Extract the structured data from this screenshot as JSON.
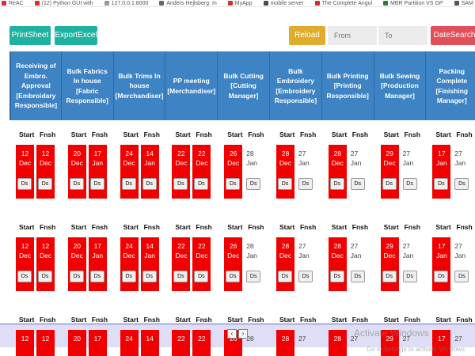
{
  "bookmarks": [
    {
      "label": "ReAC",
      "color": "#cc3333"
    },
    {
      "label": "(12) Python GUI with",
      "color": "#e52d27"
    },
    {
      "label": "127.0.0.1:8000",
      "color": "#999999"
    },
    {
      "label": "Anders Hejlsberg: In",
      "color": "#666666"
    },
    {
      "label": "MyApp",
      "color": "#d32f2f"
    },
    {
      "label": "mobile server",
      "color": "#4a4a4a"
    },
    {
      "label": "The Complete Angul",
      "color": "#d32f2f"
    },
    {
      "label": "MBR Partition VS GP",
      "color": "#2e7d32"
    },
    {
      "label": "SAM ONLINE",
      "color": "#555555"
    }
  ],
  "toolbar": {
    "print_label": "PrintSheet",
    "excel_label": "ExportExcel",
    "reload_label": "Reload",
    "from_placeholder": "From",
    "to_placeholder": "To",
    "datesearch_label": "DateSearch"
  },
  "colors": {
    "teal": "#20b2a0",
    "reload": "#e0ac2c",
    "datesearch": "#e14f58",
    "header": "#3e83c4",
    "overdue": "#f00000"
  },
  "columns": [
    [
      "Receiving of",
      "Embro.",
      "Approval",
      "[Embroidary",
      "Responsible]"
    ],
    [
      "Bulk Fabrics",
      "In house",
      "[Fabric",
      "Responsible]"
    ],
    [
      "Bulk Trims In",
      "house",
      "[Merchandiser]"
    ],
    [
      "PP meeting",
      "[Merchandiser]"
    ],
    [
      "Bulk Cutting",
      "[Cutting",
      "Manager]"
    ],
    [
      "Bulk",
      "Embroidery",
      "[Embroidery",
      "Responsible]"
    ],
    [
      "Bulk Printing",
      "[Printing",
      "Responsible]"
    ],
    [
      "Bulk Sewing",
      "[Production",
      "Manager]"
    ],
    [
      "Packing",
      "Complete",
      "[Finishing",
      "Manager]"
    ]
  ],
  "cell_labels": {
    "start": "Start",
    "finish": "Fnsh",
    "ds": "Ds"
  },
  "rows": [
    [
      {
        "s": [
          "12",
          "Dec"
        ],
        "f": [
          "12",
          "Dec"
        ],
        "s_red": true,
        "f_red": true
      },
      {
        "s": [
          "20",
          "Dec"
        ],
        "f": [
          "17",
          "Jan"
        ],
        "s_red": true,
        "f_red": true
      },
      {
        "s": [
          "24",
          "Dec"
        ],
        "f": [
          "14",
          "Jan"
        ],
        "s_red": true,
        "f_red": true
      },
      {
        "s": [
          "22",
          "Dec"
        ],
        "f": [
          "22",
          "Dec"
        ],
        "s_red": true,
        "f_red": true
      },
      {
        "s": [
          "26",
          "Dec"
        ],
        "f": [
          "28",
          "Jan"
        ],
        "s_red": true,
        "f_red": false
      },
      {
        "s": [
          "28",
          "Dec"
        ],
        "f": [
          "27",
          "Jan"
        ],
        "s_red": true,
        "f_red": false
      },
      {
        "s": [
          "28",
          "Dec"
        ],
        "f": [
          "27",
          "Jan"
        ],
        "s_red": true,
        "f_red": false
      },
      {
        "s": [
          "29",
          "Dec"
        ],
        "f": [
          "27",
          "Jan"
        ],
        "s_red": true,
        "f_red": false
      },
      {
        "s": [
          "17",
          "Jan"
        ],
        "f": [
          "27",
          "Jan"
        ],
        "s_red": true,
        "f_red": false
      }
    ],
    [
      {
        "s": [
          "12",
          "Dec"
        ],
        "f": [
          "12",
          "Dec"
        ],
        "s_red": true,
        "f_red": true
      },
      {
        "s": [
          "20",
          "Dec"
        ],
        "f": [
          "17",
          "Jan"
        ],
        "s_red": true,
        "f_red": true
      },
      {
        "s": [
          "24",
          "Dec"
        ],
        "f": [
          "14",
          "Jan"
        ],
        "s_red": true,
        "f_red": true
      },
      {
        "s": [
          "22",
          "Dec"
        ],
        "f": [
          "22",
          "Dec"
        ],
        "s_red": true,
        "f_red": true
      },
      {
        "s": [
          "26",
          "Dec"
        ],
        "f": [
          "28",
          "Jan"
        ],
        "s_red": true,
        "f_red": false
      },
      {
        "s": [
          "28",
          "Dec"
        ],
        "f": [
          "27",
          "Jan"
        ],
        "s_red": true,
        "f_red": false
      },
      {
        "s": [
          "28",
          "Dec"
        ],
        "f": [
          "27",
          "Jan"
        ],
        "s_red": true,
        "f_red": false
      },
      {
        "s": [
          "29",
          "Dec"
        ],
        "f": [
          "27",
          "Jan"
        ],
        "s_red": true,
        "f_red": false
      },
      {
        "s": [
          "17",
          "Jan"
        ],
        "f": [
          "27",
          "Jan"
        ],
        "s_red": true,
        "f_red": false
      }
    ],
    [
      {
        "s": [
          "12"
        ],
        "f": [
          "12"
        ],
        "s_red": true,
        "f_red": true
      },
      {
        "s": [
          "20"
        ],
        "f": [
          "17"
        ],
        "s_red": true,
        "f_red": true
      },
      {
        "s": [
          "24"
        ],
        "f": [
          "14"
        ],
        "s_red": true,
        "f_red": true
      },
      {
        "s": [
          "22"
        ],
        "f": [
          "22"
        ],
        "s_red": true,
        "f_red": true
      },
      {
        "s": [
          "26"
        ],
        "f": [
          "28"
        ],
        "s_red": true,
        "f_red": false
      },
      {
        "s": [
          "28"
        ],
        "f": [
          "27"
        ],
        "s_red": true,
        "f_red": false
      },
      {
        "s": [
          "28"
        ],
        "f": [
          "27"
        ],
        "s_red": true,
        "f_red": false
      },
      {
        "s": [
          "29"
        ],
        "f": [
          "27"
        ],
        "s_red": true,
        "f_red": false
      },
      {
        "s": [
          "17"
        ],
        "f": [
          "27"
        ],
        "s_red": true,
        "f_red": false
      }
    ]
  ],
  "windows_watermark": {
    "line1": "Activate Windows",
    "line2": "Go to Settings to activate Windows."
  },
  "scroll_arrows": {
    "left": "‹",
    "right": "›"
  }
}
